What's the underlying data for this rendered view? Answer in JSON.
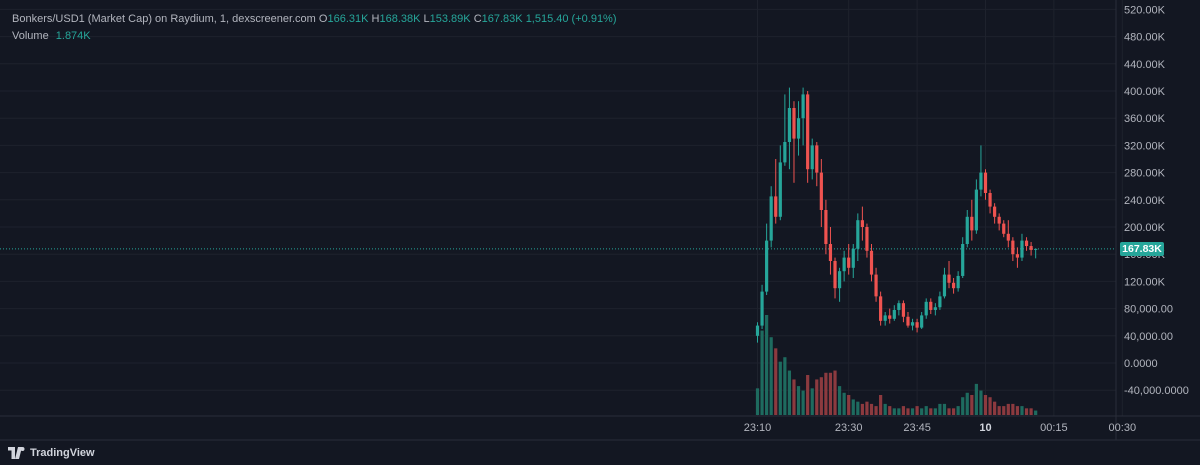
{
  "legend": {
    "symbol": "Bonkers/USD1 (Market Cap) on Raydium, 1, dexscreener.com",
    "o_label": "O",
    "o_value": "166.31K",
    "h_label": "H",
    "h_value": "168.38K",
    "l_label": "L",
    "l_value": "153.89K",
    "c_label": "C",
    "c_value": "167.83K",
    "change": "1,515.40 (+0.91%)",
    "volume_label": "Volume",
    "volume_value": "1.874K"
  },
  "branding": {
    "logo_text": "TradingView",
    "logo_icon": "tradingview-logo-icon"
  },
  "colors": {
    "background": "#131722",
    "up": "#26a69a",
    "down": "#ef5350",
    "up_volume": "#1e6b5f",
    "down_volume": "#8c3a3f",
    "grid": "#1e222d",
    "text": "#b2b5be"
  },
  "chart_data": {
    "type": "candlestick",
    "y_axis": {
      "ticks": [
        {
          "value": 520000,
          "label": "520.00K"
        },
        {
          "value": 480000,
          "label": "480.00K"
        },
        {
          "value": 440000,
          "label": "440.00K"
        },
        {
          "value": 400000,
          "label": "400.00K"
        },
        {
          "value": 360000,
          "label": "360.00K"
        },
        {
          "value": 320000,
          "label": "320.00K"
        },
        {
          "value": 280000,
          "label": "280.00K"
        },
        {
          "value": 240000,
          "label": "240.00K"
        },
        {
          "value": 200000,
          "label": "200.00K"
        },
        {
          "value": 160000,
          "label": "160.00K"
        },
        {
          "value": 120000,
          "label": "120.00K"
        },
        {
          "value": 80000,
          "label": "80,000.00"
        },
        {
          "value": 40000,
          "label": "40,000.00"
        },
        {
          "value": 0,
          "label": "0.0000"
        },
        {
          "value": -40000,
          "label": "-40,000.0000"
        }
      ],
      "range": [
        -60000,
        527000
      ]
    },
    "x_axis": {
      "ticks": [
        {
          "label": "23:10",
          "minute": 0,
          "bold": false
        },
        {
          "label": "23:30",
          "minute": 20,
          "bold": false
        },
        {
          "label": "23:45",
          "minute": 35,
          "bold": false
        },
        {
          "label": "10",
          "minute": 50,
          "bold": true
        },
        {
          "label": "00:15",
          "minute": 65,
          "bold": false
        },
        {
          "label": "00:30",
          "minute": 80,
          "bold": false
        }
      ]
    },
    "last_price": {
      "value": 167830,
      "label": "167.83K"
    },
    "candles": [
      {
        "o": 40000,
        "h": 60000,
        "l": 30000,
        "c": 55000,
        "v": 1.2
      },
      {
        "o": 55000,
        "h": 115000,
        "l": 50000,
        "c": 105000,
        "v": 3.8
      },
      {
        "o": 105000,
        "h": 205000,
        "l": 100000,
        "c": 180000,
        "v": 4.5
      },
      {
        "o": 180000,
        "h": 260000,
        "l": 170000,
        "c": 245000,
        "v": 3.5
      },
      {
        "o": 245000,
        "h": 300000,
        "l": 205000,
        "c": 215000,
        "v": 3.0
      },
      {
        "o": 215000,
        "h": 320000,
        "l": 210000,
        "c": 295000,
        "v": 2.4
      },
      {
        "o": 295000,
        "h": 395000,
        "l": 290000,
        "c": 325000,
        "v": 2.6
      },
      {
        "o": 325000,
        "h": 405000,
        "l": 285000,
        "c": 375000,
        "v": 2.0
      },
      {
        "o": 375000,
        "h": 385000,
        "l": 265000,
        "c": 330000,
        "v": 1.6
      },
      {
        "o": 330000,
        "h": 385000,
        "l": 305000,
        "c": 360000,
        "v": 1.3
      },
      {
        "o": 360000,
        "h": 405000,
        "l": 320000,
        "c": 395000,
        "v": 1.1
      },
      {
        "o": 395000,
        "h": 400000,
        "l": 265000,
        "c": 285000,
        "v": 1.8
      },
      {
        "o": 285000,
        "h": 330000,
        "l": 270000,
        "c": 320000,
        "v": 1.2
      },
      {
        "o": 320000,
        "h": 325000,
        "l": 260000,
        "c": 280000,
        "v": 1.6
      },
      {
        "o": 280000,
        "h": 300000,
        "l": 200000,
        "c": 225000,
        "v": 1.7
      },
      {
        "o": 225000,
        "h": 240000,
        "l": 160000,
        "c": 175000,
        "v": 1.9
      },
      {
        "o": 175000,
        "h": 200000,
        "l": 130000,
        "c": 150000,
        "v": 1.9
      },
      {
        "o": 150000,
        "h": 155000,
        "l": 95000,
        "c": 110000,
        "v": 2.0
      },
      {
        "o": 110000,
        "h": 140000,
        "l": 90000,
        "c": 135000,
        "v": 1.3
      },
      {
        "o": 135000,
        "h": 165000,
        "l": 120000,
        "c": 155000,
        "v": 1.0
      },
      {
        "o": 155000,
        "h": 175000,
        "l": 130000,
        "c": 140000,
        "v": 0.9
      },
      {
        "o": 140000,
        "h": 175000,
        "l": 125000,
        "c": 168000,
        "v": 0.7
      },
      {
        "o": 168000,
        "h": 220000,
        "l": 150000,
        "c": 210000,
        "v": 0.6
      },
      {
        "o": 210000,
        "h": 230000,
        "l": 180000,
        "c": 200000,
        "v": 0.5
      },
      {
        "o": 200000,
        "h": 205000,
        "l": 155000,
        "c": 165000,
        "v": 0.6
      },
      {
        "o": 165000,
        "h": 175000,
        "l": 120000,
        "c": 130000,
        "v": 0.5
      },
      {
        "o": 130000,
        "h": 140000,
        "l": 90000,
        "c": 98000,
        "v": 0.4
      },
      {
        "o": 98000,
        "h": 105000,
        "l": 55000,
        "c": 62000,
        "v": 0.9
      },
      {
        "o": 62000,
        "h": 75000,
        "l": 55000,
        "c": 70000,
        "v": 0.5
      },
      {
        "o": 70000,
        "h": 80000,
        "l": 58000,
        "c": 65000,
        "v": 0.4
      },
      {
        "o": 65000,
        "h": 85000,
        "l": 62000,
        "c": 78000,
        "v": 0.3
      },
      {
        "o": 78000,
        "h": 92000,
        "l": 70000,
        "c": 88000,
        "v": 0.3
      },
      {
        "o": 88000,
        "h": 92000,
        "l": 60000,
        "c": 68000,
        "v": 0.4
      },
      {
        "o": 68000,
        "h": 75000,
        "l": 52000,
        "c": 55000,
        "v": 0.3
      },
      {
        "o": 55000,
        "h": 65000,
        "l": 48000,
        "c": 60000,
        "v": 0.3
      },
      {
        "o": 60000,
        "h": 65000,
        "l": 45000,
        "c": 52000,
        "v": 0.4
      },
      {
        "o": 52000,
        "h": 75000,
        "l": 50000,
        "c": 70000,
        "v": 0.3
      },
      {
        "o": 70000,
        "h": 95000,
        "l": 65000,
        "c": 90000,
        "v": 0.4
      },
      {
        "o": 90000,
        "h": 95000,
        "l": 72000,
        "c": 78000,
        "v": 0.3
      },
      {
        "o": 78000,
        "h": 88000,
        "l": 70000,
        "c": 82000,
        "v": 0.3
      },
      {
        "o": 82000,
        "h": 105000,
        "l": 78000,
        "c": 98000,
        "v": 0.5
      },
      {
        "o": 98000,
        "h": 140000,
        "l": 95000,
        "c": 130000,
        "v": 0.5
      },
      {
        "o": 130000,
        "h": 150000,
        "l": 110000,
        "c": 118000,
        "v": 0.3
      },
      {
        "o": 118000,
        "h": 125000,
        "l": 102000,
        "c": 110000,
        "v": 0.3
      },
      {
        "o": 110000,
        "h": 135000,
        "l": 105000,
        "c": 128000,
        "v": 0.4
      },
      {
        "o": 128000,
        "h": 185000,
        "l": 125000,
        "c": 175000,
        "v": 0.8
      },
      {
        "o": 175000,
        "h": 225000,
        "l": 170000,
        "c": 215000,
        "v": 1.0
      },
      {
        "o": 215000,
        "h": 240000,
        "l": 180000,
        "c": 195000,
        "v": 0.9
      },
      {
        "o": 195000,
        "h": 270000,
        "l": 190000,
        "c": 255000,
        "v": 1.4
      },
      {
        "o": 255000,
        "h": 320000,
        "l": 245000,
        "c": 280000,
        "v": 1.1
      },
      {
        "o": 280000,
        "h": 285000,
        "l": 240000,
        "c": 250000,
        "v": 0.9
      },
      {
        "o": 250000,
        "h": 255000,
        "l": 220000,
        "c": 230000,
        "v": 0.8
      },
      {
        "o": 230000,
        "h": 235000,
        "l": 205000,
        "c": 215000,
        "v": 0.6
      },
      {
        "o": 215000,
        "h": 220000,
        "l": 195000,
        "c": 205000,
        "v": 0.4
      },
      {
        "o": 205000,
        "h": 210000,
        "l": 185000,
        "c": 190000,
        "v": 0.4
      },
      {
        "o": 190000,
        "h": 210000,
        "l": 170000,
        "c": 180000,
        "v": 0.5
      },
      {
        "o": 180000,
        "h": 185000,
        "l": 150000,
        "c": 160000,
        "v": 0.5
      },
      {
        "o": 160000,
        "h": 170000,
        "l": 140000,
        "c": 155000,
        "v": 0.4
      },
      {
        "o": 155000,
        "h": 190000,
        "l": 150000,
        "c": 180000,
        "v": 0.4
      },
      {
        "o": 180000,
        "h": 185000,
        "l": 165000,
        "c": 172000,
        "v": 0.3
      },
      {
        "o": 172000,
        "h": 178000,
        "l": 158000,
        "c": 166310,
        "v": 0.3
      },
      {
        "o": 166310,
        "h": 168380,
        "l": 153890,
        "c": 167830,
        "v": 0.2
      }
    ],
    "volume_max": 4.5
  }
}
